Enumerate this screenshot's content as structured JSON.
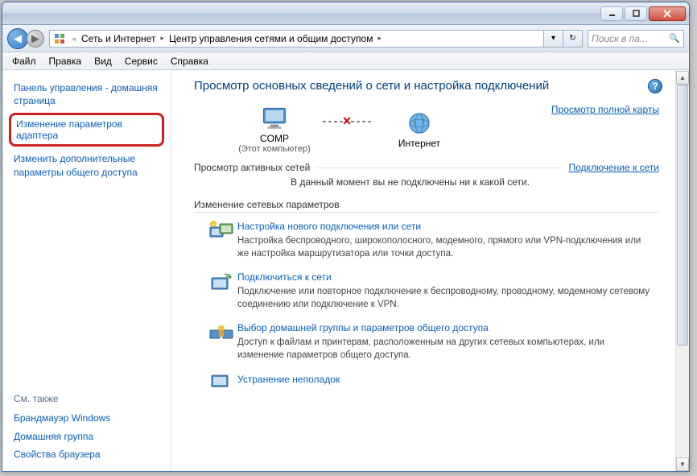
{
  "breadcrumb": {
    "seg1": "Сеть и Интернет",
    "seg2": "Центр управления сетями и общим доступом"
  },
  "search": {
    "placeholder": "Поиск в па..."
  },
  "menubar": {
    "file": "Файл",
    "edit": "Правка",
    "view": "Вид",
    "service": "Сервис",
    "help": "Справка"
  },
  "sidebar": {
    "home": "Панель управления - домашняя страница",
    "adapter": "Изменение параметров адаптера",
    "sharing": "Изменить дополнительные параметры общего доступа",
    "see_also": "См. также",
    "firewall": "Брандмауэр Windows",
    "homegroup": "Домашняя группа",
    "browser": "Свойства браузера"
  },
  "main": {
    "title": "Просмотр основных сведений о сети и настройка подключений",
    "map_link": "Просмотр полной карты",
    "node1": "COMP",
    "node1_sub": "(Этот компьютер)",
    "node2": "Интернет",
    "active_header": "Просмотр активных сетей",
    "connect_link": "Подключение к сети",
    "no_network": "В данный момент вы не подключены ни к какой сети.",
    "change_header": "Изменение сетевых параметров",
    "tasks": [
      {
        "title": "Настройка нового подключения или сети",
        "desc": "Настройка беспроводного, широкополосного, модемного, прямого или VPN-подключения или же настройка маршрутизатора или точки доступа."
      },
      {
        "title": "Подключиться к сети",
        "desc": "Подключение или повторное подключение к беспроводному, проводному, модемному сетевому соединению или подключение к VPN."
      },
      {
        "title": "Выбор домашней группы и параметров общего доступа",
        "desc": "Доступ к файлам и принтерам, расположенным на других сетевых компьютерах, или изменение параметров общего доступа."
      },
      {
        "title": "Устранение неполадок",
        "desc": ""
      }
    ]
  }
}
